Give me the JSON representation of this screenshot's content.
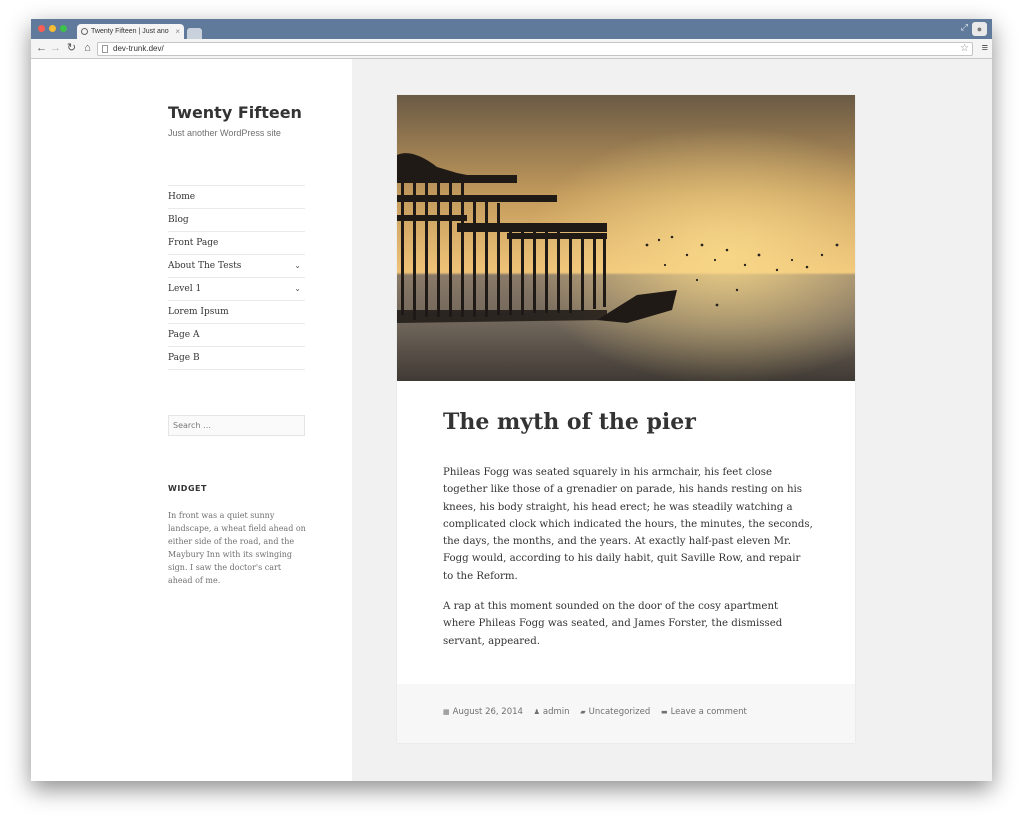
{
  "browser": {
    "tab_title": "Twenty Fifteen | Just another",
    "tab_close": "×",
    "url": "dev-trunk.dev/",
    "icons": {
      "back": "back-arrow-icon",
      "forward": "forward-arrow-icon",
      "reload": "reload-icon",
      "home": "home-icon",
      "star": "bookmark-star-icon",
      "menu": "hamburger-menu-icon",
      "back_glyph": "←",
      "forward_glyph": "→",
      "reload_glyph": "↻",
      "home_glyph": "⌂",
      "star_glyph": "☆",
      "menu_glyph": "≡",
      "fullscreen_glyph": "⤢"
    }
  },
  "site": {
    "title": "Twenty Fifteen",
    "description": "Just another WordPress site"
  },
  "menu": {
    "items": [
      {
        "label": "Home",
        "has_submenu": false
      },
      {
        "label": "Blog",
        "has_submenu": false
      },
      {
        "label": "Front Page",
        "has_submenu": false
      },
      {
        "label": "About The Tests",
        "has_submenu": true
      },
      {
        "label": "Level 1",
        "has_submenu": true
      },
      {
        "label": "Lorem Ipsum",
        "has_submenu": false
      },
      {
        "label": "Page A",
        "has_submenu": false
      },
      {
        "label": "Page B",
        "has_submenu": false
      }
    ],
    "chevron": "⌄"
  },
  "search": {
    "placeholder": "Search …"
  },
  "widget": {
    "title": "WIDGET",
    "text": "In front was a quiet sunny landscape, a wheat field ahead on either side of the road, and the Maybury Inn with its swinging sign. I saw the doctor's cart ahead of me."
  },
  "post": {
    "title": "The myth of the pier",
    "paragraphs": [
      "Phileas Fogg was seated squarely in his armchair, his feet close together like those of a grenadier on parade, his hands resting on his knees, his body straight, his head erect; he was steadily watching a complicated clock which indicated the hours, the minutes, the seconds, the days, the months, and the years. At exactly half-past eleven Mr. Fogg would, according to his daily habit, quit Saville Row, and repair to the Reform.",
      "A rap at this moment sounded on the door of the cosy apartment where Phileas Fogg was seated, and James Forster, the dismissed servant, appeared."
    ],
    "meta": {
      "date": "August 26, 2014",
      "author": "admin",
      "category": "Uncategorized",
      "comments": "Leave a comment",
      "date_icon": "▦",
      "author_icon": "♟",
      "category_icon": "▰",
      "comments_icon": "▬"
    }
  },
  "colors": {
    "tabbar": "#5f7a9a",
    "page_bg": "#f1f1f1",
    "sidebar_bg": "#ffffff",
    "text": "#333333",
    "muted": "#707070"
  }
}
